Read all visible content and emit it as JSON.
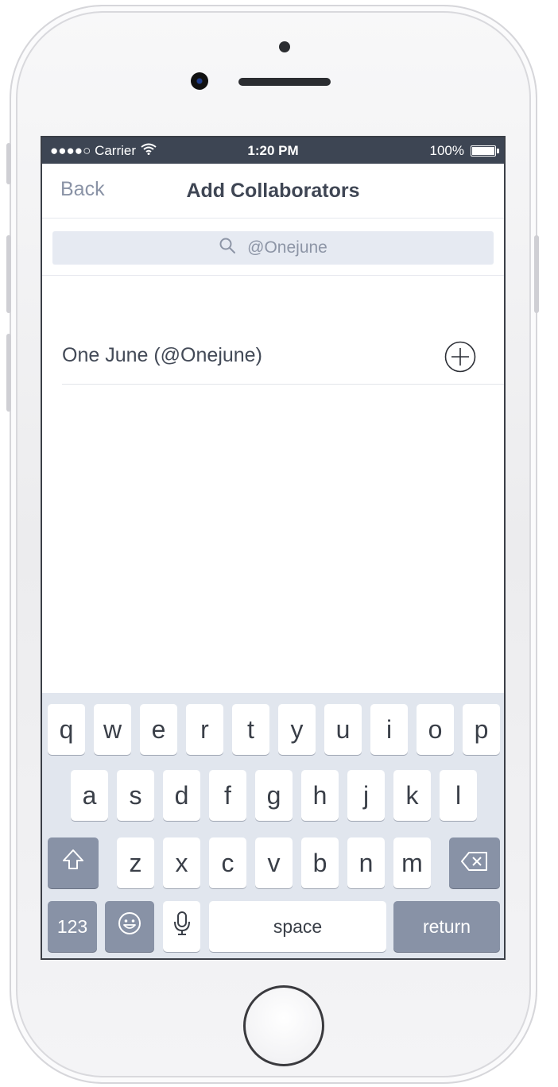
{
  "status_bar": {
    "carrier": "●●●●○ Carrier",
    "time": "1:20 PM",
    "battery": "100%"
  },
  "nav": {
    "back_label": "Back",
    "title": "Add Collaborators"
  },
  "search": {
    "query": "@Onejune"
  },
  "results": [
    {
      "label": "One June (@Onejune)"
    }
  ],
  "keyboard": {
    "row1": [
      "q",
      "w",
      "e",
      "r",
      "t",
      "y",
      "u",
      "i",
      "o",
      "p"
    ],
    "row2": [
      "a",
      "s",
      "d",
      "f",
      "g",
      "h",
      "j",
      "k",
      "l"
    ],
    "row3": [
      "z",
      "x",
      "c",
      "v",
      "b",
      "n",
      "m"
    ],
    "numbers_label": "123",
    "space_label": "space",
    "return_label": "return"
  },
  "colors": {
    "status_bar": "#3d4553",
    "keyboard_bg": "#e1e6ee",
    "dark_key": "#8892a6",
    "search_bg": "#e6eaf2"
  },
  "icons": [
    "wifi-icon",
    "battery-icon",
    "search-icon",
    "add-circle-icon",
    "shift-icon",
    "backspace-icon",
    "emoji-icon",
    "microphone-icon"
  ]
}
